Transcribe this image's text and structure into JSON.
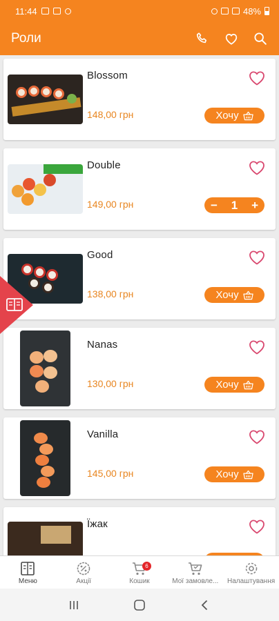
{
  "status_bar": {
    "time": "11:44",
    "battery": "48%"
  },
  "app_bar": {
    "title": "Роли",
    "actions": [
      {
        "icon": "phone-icon"
      },
      {
        "icon": "heart-icon"
      },
      {
        "icon": "search-icon"
      }
    ]
  },
  "products": [
    {
      "name": "Blossom",
      "price": "148,00 грн",
      "button_label": "Хочу"
    },
    {
      "name": "Double",
      "price": "149,00 грн",
      "quantity": "1"
    },
    {
      "name": "Good",
      "price": "138,00 грн",
      "button_label": "Хочу"
    },
    {
      "name": "Nanas",
      "price": "130,00 грн",
      "button_label": "Хочу"
    },
    {
      "name": "Vanilla",
      "price": "145,00 грн",
      "button_label": "Хочу"
    },
    {
      "name": "Їжак",
      "price": "",
      "button_label": ""
    }
  ],
  "stepper_labels": {
    "minus": "−",
    "plus": "+"
  },
  "bottom_nav": {
    "items": [
      {
        "label": "Меню",
        "icon": "menu-book-icon"
      },
      {
        "label": "Акції",
        "icon": "percent-badge-icon"
      },
      {
        "label": "Кошик",
        "icon": "cart-icon",
        "badge": "6"
      },
      {
        "label": "Мої замовле...",
        "icon": "orders-cart-icon"
      },
      {
        "label": "Налаштування",
        "icon": "settings-gear-icon"
      }
    ]
  },
  "colors": {
    "accent": "#f5841f",
    "price": "#e8851f",
    "heart": "#d9486f",
    "side_tab": "#e4434b"
  }
}
